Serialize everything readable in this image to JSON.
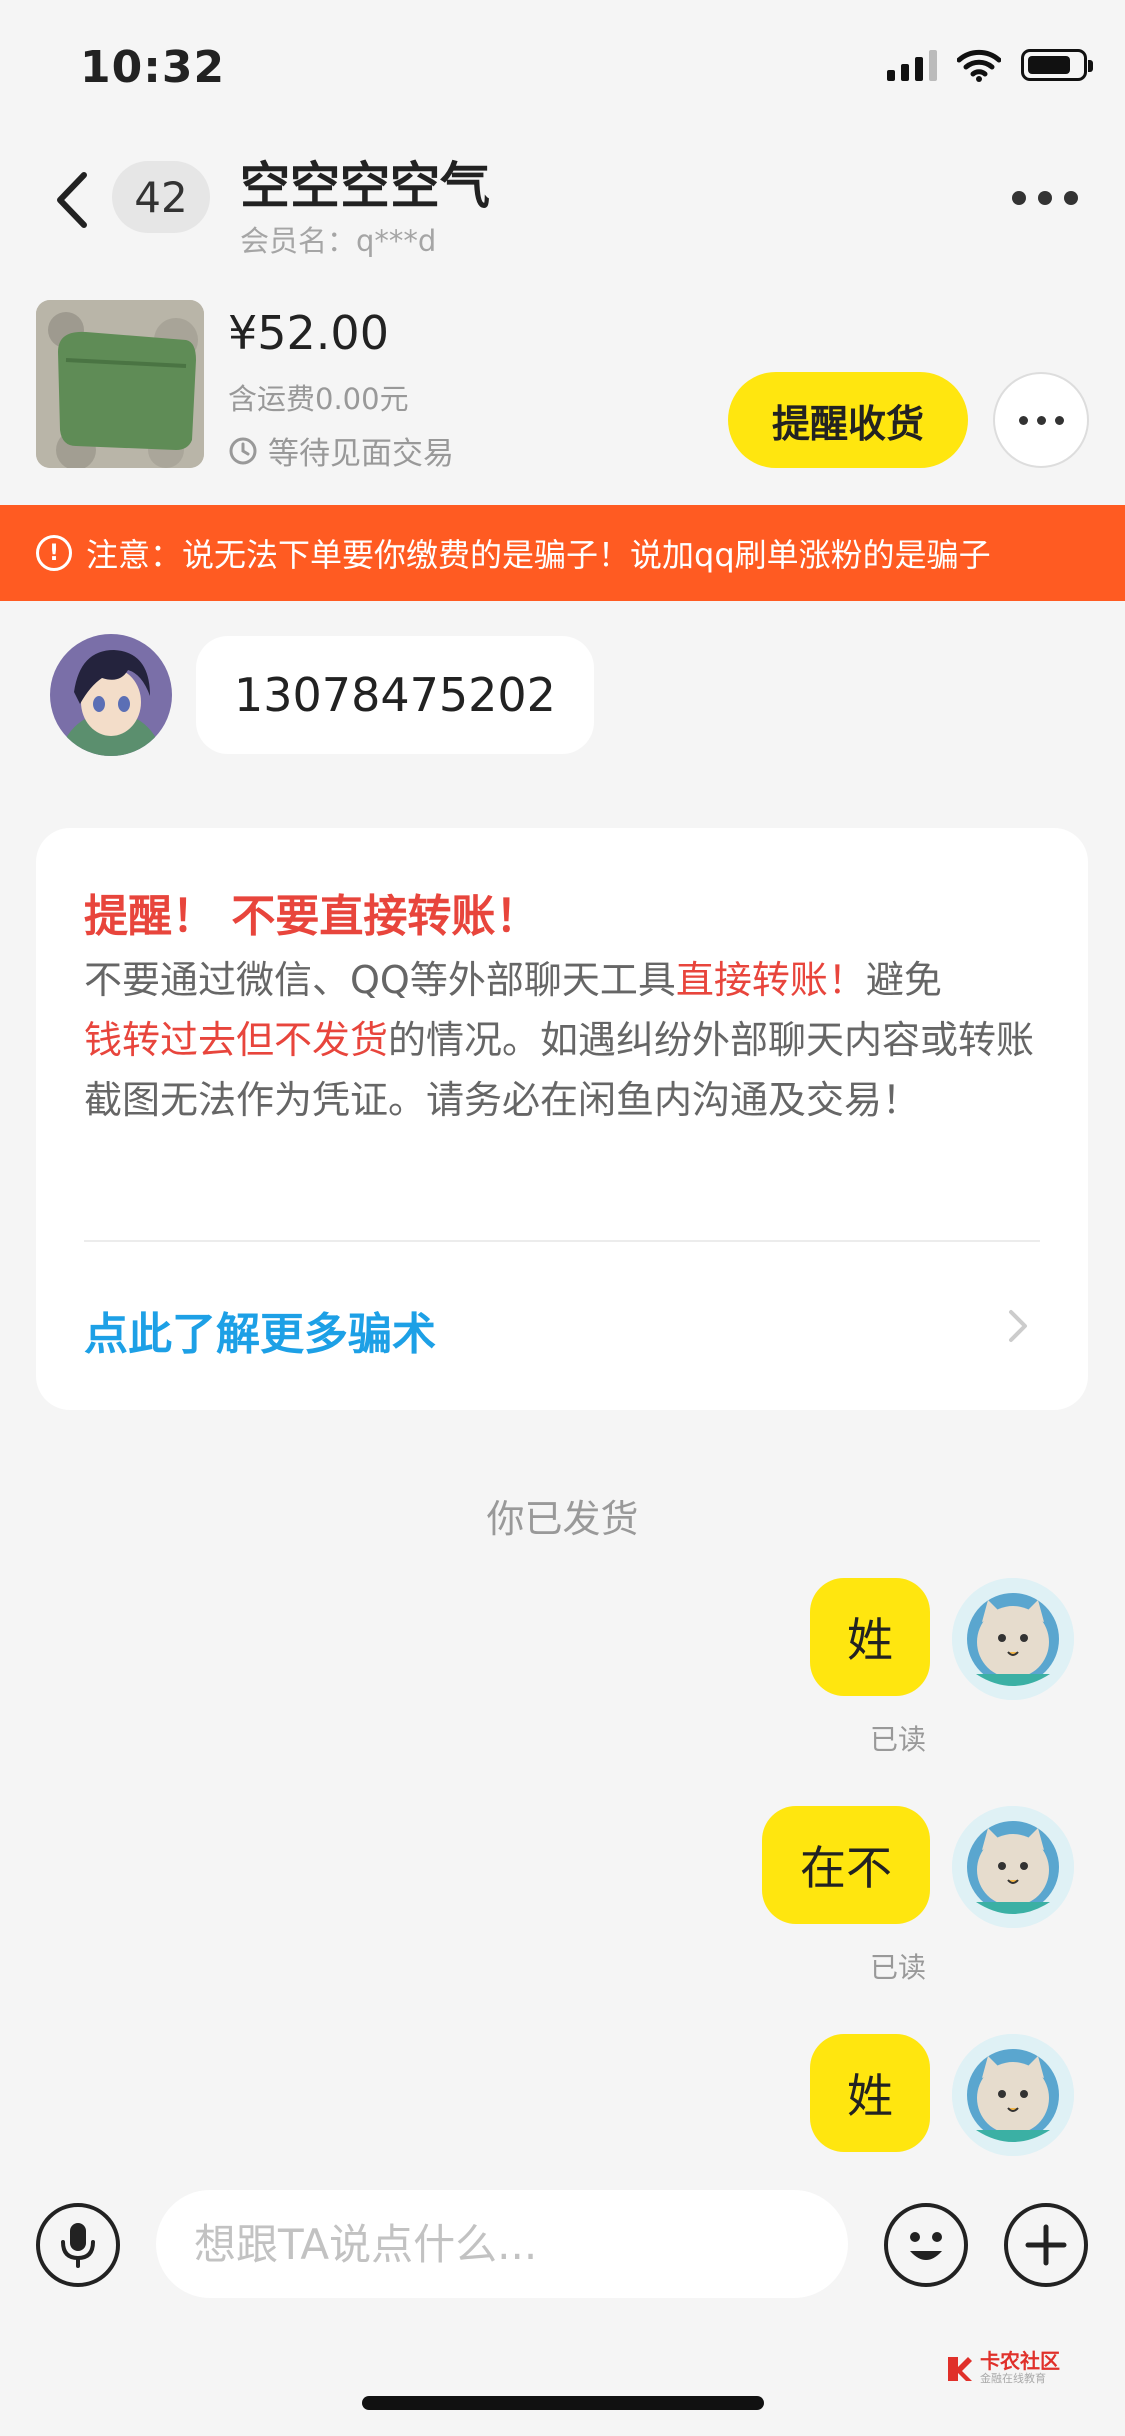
{
  "status_bar": {
    "time": "10:32"
  },
  "header": {
    "unread_count": "42",
    "title": "空空空空气",
    "subtitle": "会员名：q***d"
  },
  "item": {
    "price": "¥52.00",
    "shipping": "含运费0.00元",
    "trade_status": "等待见面交易",
    "remind_button": "提醒收货"
  },
  "warning_banner": "注意：说无法下单要你缴费的是骗子！说加qq刷单涨粉的是骗子",
  "messages": {
    "incoming_text": "13078475202",
    "system_text": "你已发货",
    "outgoing": [
      {
        "text": "姓",
        "status": "已读"
      },
      {
        "text": "在不",
        "status": "已读"
      },
      {
        "text": "姓"
      }
    ]
  },
  "safety": {
    "title": "提醒！ 不要直接转账！",
    "body_1": "不要通过微信、QQ等外部聊天工具",
    "body_red_1": "直接转账！",
    "body_2": "避免",
    "body_red_2": "钱转过去但不发货",
    "body_3": "的情况。如遇纠纷外部聊天内容或转账截图无法作为凭证。请务必在闲鱼内沟通及交易！",
    "link": "点此了解更多骗术"
  },
  "input": {
    "placeholder": "想跟TA说点什么..."
  },
  "watermark": {
    "line1": "卡农社区",
    "line2": "金融在线教育"
  },
  "colors": {
    "accent_yellow": "#ffe60f",
    "warning_orange": "#ff5b22",
    "alert_red": "#e8453c",
    "link_blue": "#1da0e6"
  },
  "icons": [
    "back-arrow-icon",
    "more-dots-icon",
    "clock-icon",
    "alert-circle-icon",
    "chevron-right-icon",
    "microphone-icon",
    "emoji-icon",
    "plus-icon"
  ]
}
